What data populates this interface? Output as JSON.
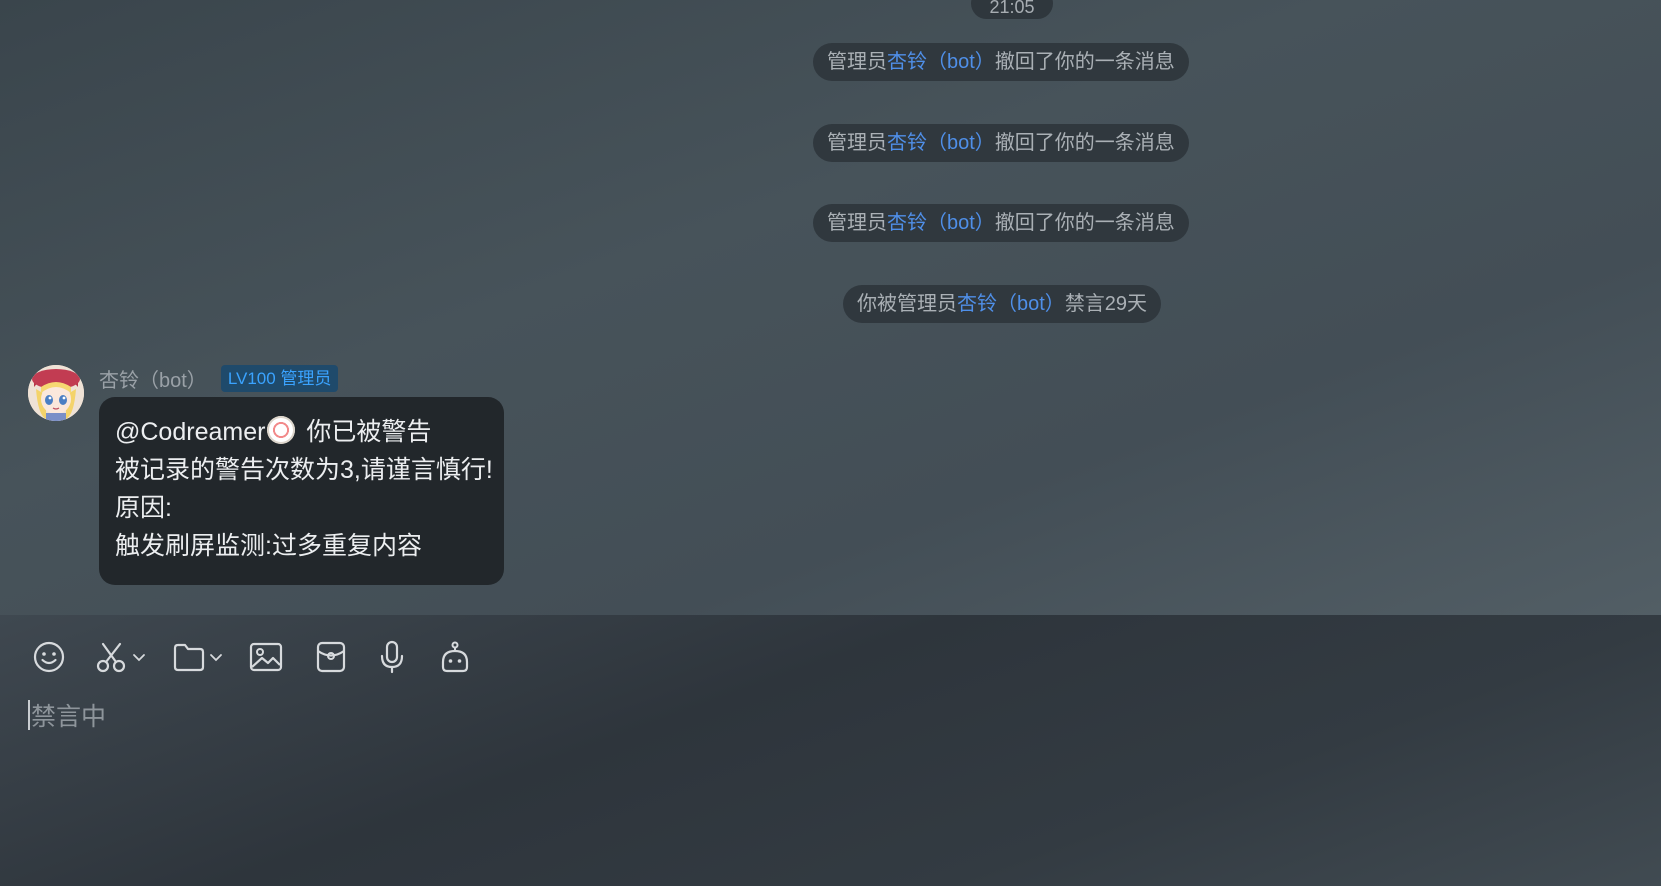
{
  "chat": {
    "timestamp": "21:05",
    "system_messages": [
      {
        "prefix": "管理员",
        "name": "杏铃（bot）",
        "suffix": "撤回了你的一条消息"
      },
      {
        "prefix": "管理员",
        "name": "杏铃（bot）",
        "suffix": "撤回了你的一条消息"
      },
      {
        "prefix": "管理员",
        "name": "杏铃（bot）",
        "suffix": "撤回了你的一条消息"
      },
      {
        "prefix": "你被管理员",
        "name": "杏铃（bot）",
        "suffix": "禁言29天"
      }
    ],
    "message": {
      "sender_name": "杏铃（bot）",
      "role_badge": "LV100 管理员",
      "mention": "@Codreamer",
      "mention_suffix": " 你已被警告",
      "line2": "被记录的警告次数为3,请谨言慎行!",
      "line3": "原因:",
      "line4": "触发刷屏监测:过多重复内容"
    }
  },
  "toolbar": {
    "icons": [
      "emoji-icon",
      "scissors-icon",
      "folder-icon",
      "image-icon",
      "red-packet-icon",
      "microphone-icon",
      "robot-icon"
    ]
  },
  "input": {
    "placeholder": "禁言中"
  },
  "colors": {
    "highlight_name": "#4f8fe8",
    "role_badge_text": "#3aa3ff",
    "role_badge_bg": "#1f4a6b",
    "bubble_bg": "#22272b"
  }
}
